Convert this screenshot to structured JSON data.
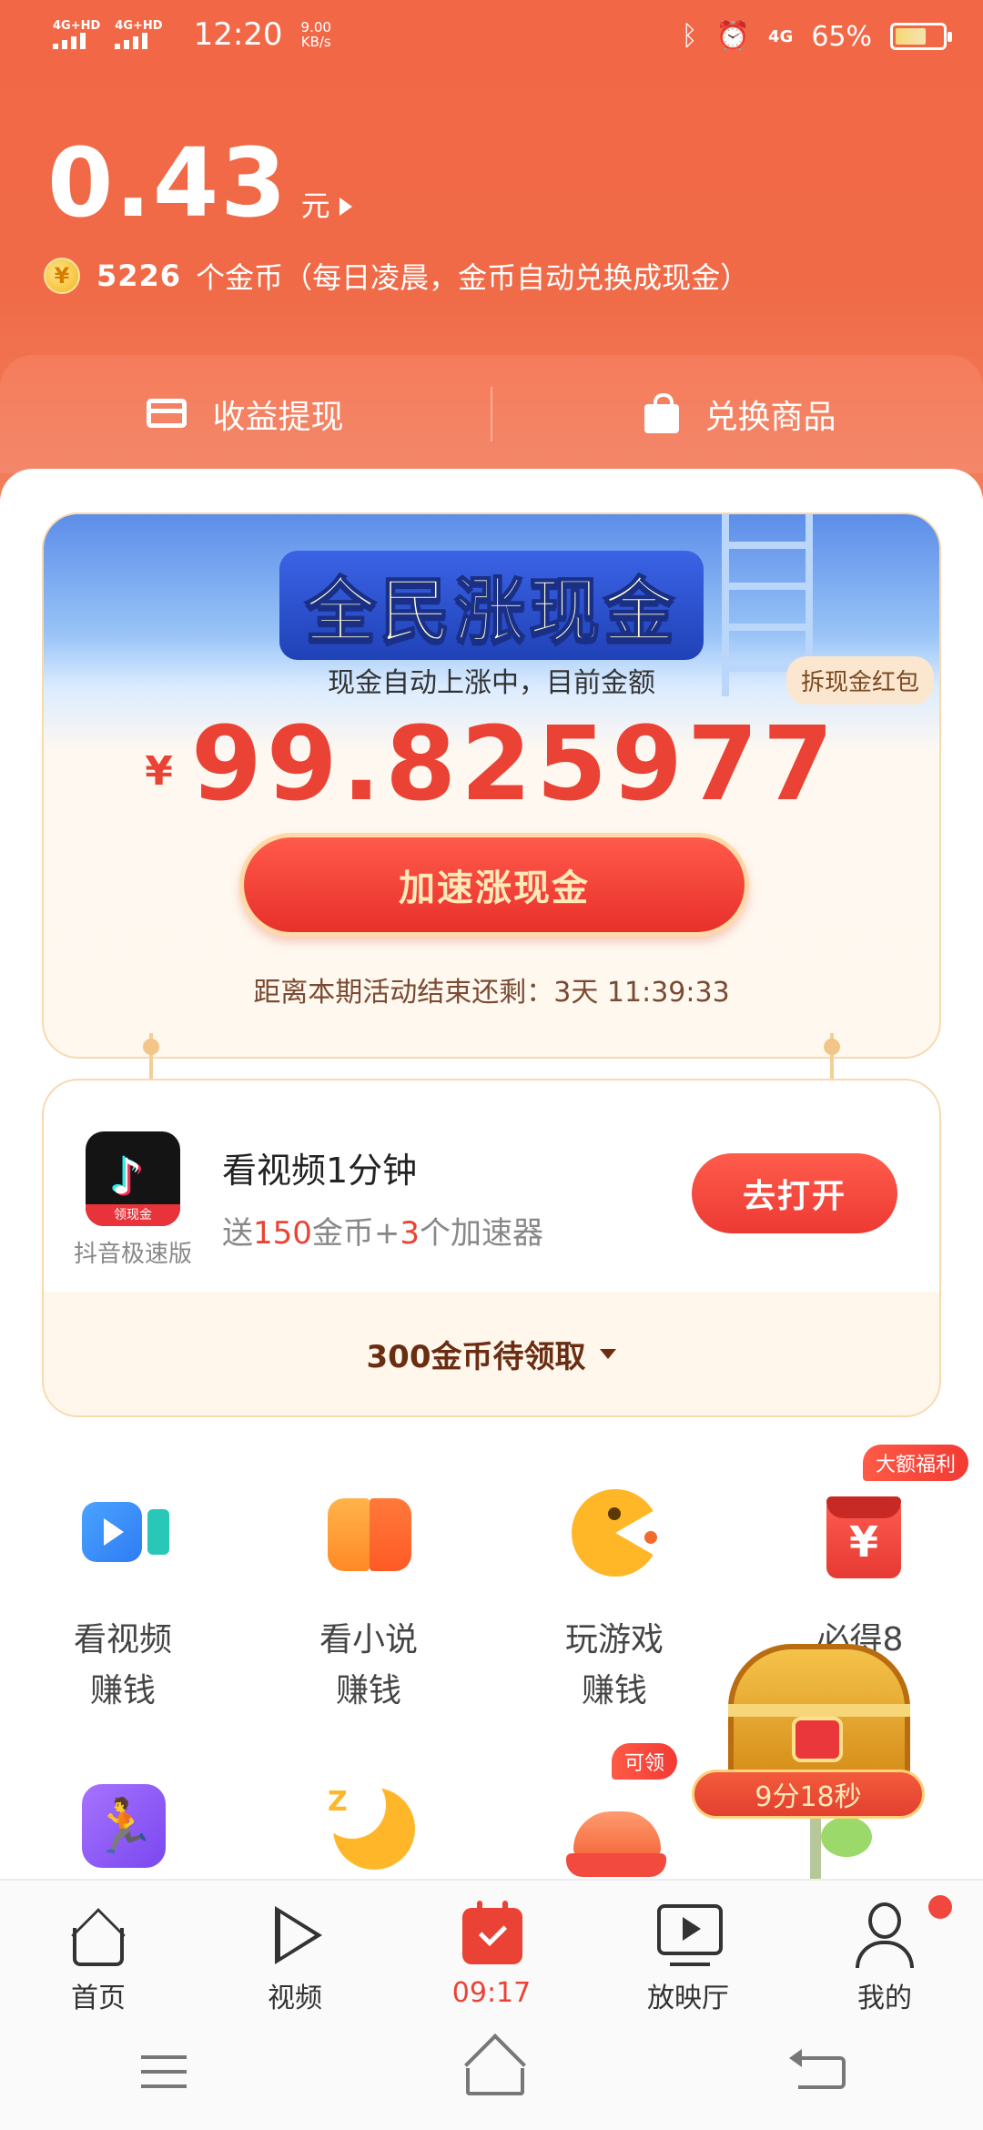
{
  "status_bar": {
    "network_1": "4G+HD",
    "network_2": "4G+HD",
    "time": "12:20",
    "speed_value": "9.00",
    "speed_unit": "KB/s",
    "bluetooth_icon": "bluetooth-icon",
    "alarm_icon": "alarm-icon",
    "signal_tag": "4G",
    "battery_percent": "65%",
    "battery_level": 0.65
  },
  "header": {
    "cash_amount": "0.43",
    "cash_unit": "元",
    "coin_symbol": "¥",
    "coins_count": "5226",
    "coins_text": "个金币（每日凌晨，金币自动兑换成现金）"
  },
  "quick_actions": [
    {
      "label": "收益提现",
      "icon": "card-withdraw-icon"
    },
    {
      "label": "兑换商品",
      "icon": "shopping-bag-icon"
    }
  ],
  "promo": {
    "title": "全民涨现金",
    "subtitle": "现金自动上涨中，目前金额",
    "tag": "拆现金红包",
    "currency": "¥",
    "amount": "99.825977",
    "button": "加速涨现金",
    "countdown": "距离本期活动结束还剩：3天 11:39:33"
  },
  "task": {
    "app_name": "抖音极速版",
    "app_band": "领现金",
    "title": "看视频1分钟",
    "reward_prefix": "送",
    "reward_coins": "150",
    "reward_mid": "金币+",
    "reward_boost": "3",
    "reward_suffix": "个加速器",
    "button": "去打开",
    "footer": "300金币待领取"
  },
  "features_row1": [
    {
      "line1": "看视频",
      "line2": "赚钱",
      "icon": "video-camera-icon"
    },
    {
      "line1": "看小说",
      "line2": "赚钱",
      "icon": "book-icon"
    },
    {
      "line1": "玩游戏",
      "line2": "赚钱",
      "icon": "pacman-game-icon"
    },
    {
      "line1": "必得8",
      "line2": "",
      "icon": "red-envelope-icon",
      "badge": "大额福利"
    }
  ],
  "features_row2": [
    {
      "icon": "running-icon"
    },
    {
      "icon": "sleep-moon-icon"
    },
    {
      "icon": "chicken-meal-icon",
      "badge": "可领"
    }
  ],
  "chest": {
    "timer": "9分18秒",
    "icon": "treasure-chest-icon"
  },
  "bottom_nav": [
    {
      "label": "首页",
      "icon": "home-icon"
    },
    {
      "label": "视频",
      "icon": "play-icon"
    },
    {
      "label": "09:17",
      "icon": "calendar-check-icon",
      "active": true
    },
    {
      "label": "放映厅",
      "icon": "tv-play-icon"
    },
    {
      "label": "我的",
      "icon": "user-icon"
    }
  ],
  "colors": {
    "accent": "#EA4335",
    "header": "#F26846",
    "gold": "#F3B51C"
  }
}
